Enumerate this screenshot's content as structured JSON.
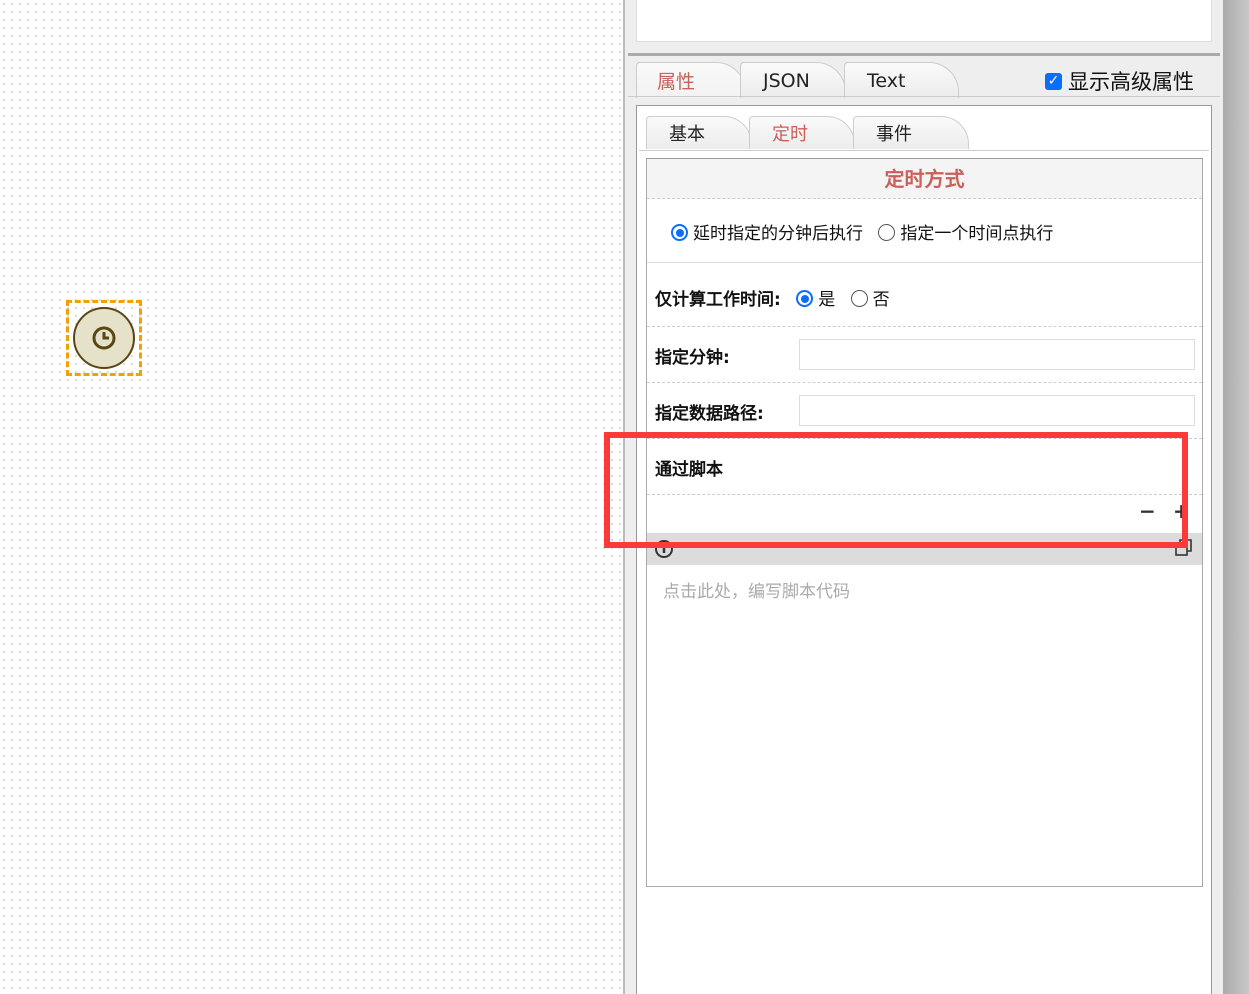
{
  "canvas": {
    "node": {
      "type": "timer",
      "icon": "clock-icon"
    }
  },
  "tabs": [
    {
      "label": "属性",
      "active": true
    },
    {
      "label": "JSON"
    },
    {
      "label": "Text"
    }
  ],
  "show_advanced": {
    "label": "显示高级属性",
    "checked": true
  },
  "subtabs": [
    {
      "label": "基本"
    },
    {
      "label": "定时",
      "active": true
    },
    {
      "label": "事件"
    }
  ],
  "form": {
    "section_title": "定时方式",
    "mode_options": [
      {
        "label": "延时指定的分钟后执行",
        "selected": true
      },
      {
        "label": "指定一个时间点执行",
        "selected": false
      }
    ],
    "work_time": {
      "label": "仅计算工作时间:",
      "yes": "是",
      "no": "否",
      "value": "是"
    },
    "minutes": {
      "label": "指定分钟:",
      "value": ""
    },
    "data_path": {
      "label": "指定数据路径:",
      "value": ""
    },
    "script": {
      "label": "通过脚本",
      "minus": "−",
      "plus": "+",
      "placeholder": "点击此处，编写脚本代码"
    }
  },
  "colors": {
    "accent": "#c9605a",
    "selection": "#f5a000",
    "highlight": "#fc3a3a",
    "radio": "#0b6ef9"
  }
}
